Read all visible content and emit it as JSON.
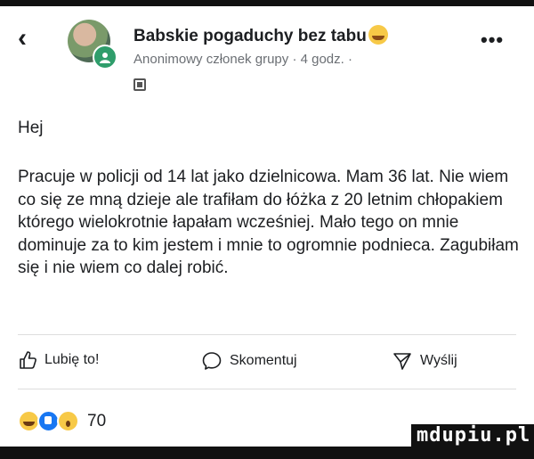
{
  "post": {
    "group_name": "Babskie pogaduchy bez tabu",
    "author": "Anonimowy członek grupy",
    "time": "4 godz.",
    "separator": "·",
    "greeting": "Hej",
    "text": "Pracuje w policji od 14 lat jako dzielnicowa. Mam 36 lat. Nie wiem co się ze mną dzieje ale trafiłam do łóżka z 20 letnim chłopakiem którego wielokrotnie łapałam wcześniej. Mało tego on mnie dominuje za to kim jestem i mnie to ogromnie podnieca. Zagubiłam się i nie wiem co dalej robić."
  },
  "actions": {
    "like": "Lubię to!",
    "comment": "Skomentuj",
    "share": "Wyślij"
  },
  "reactions": {
    "count": "70",
    "types": [
      "haha-icon",
      "like-icon",
      "wow-icon"
    ]
  },
  "icons": {
    "back": "‹",
    "more": "•••"
  },
  "watermark": "mdupiu.pl"
}
